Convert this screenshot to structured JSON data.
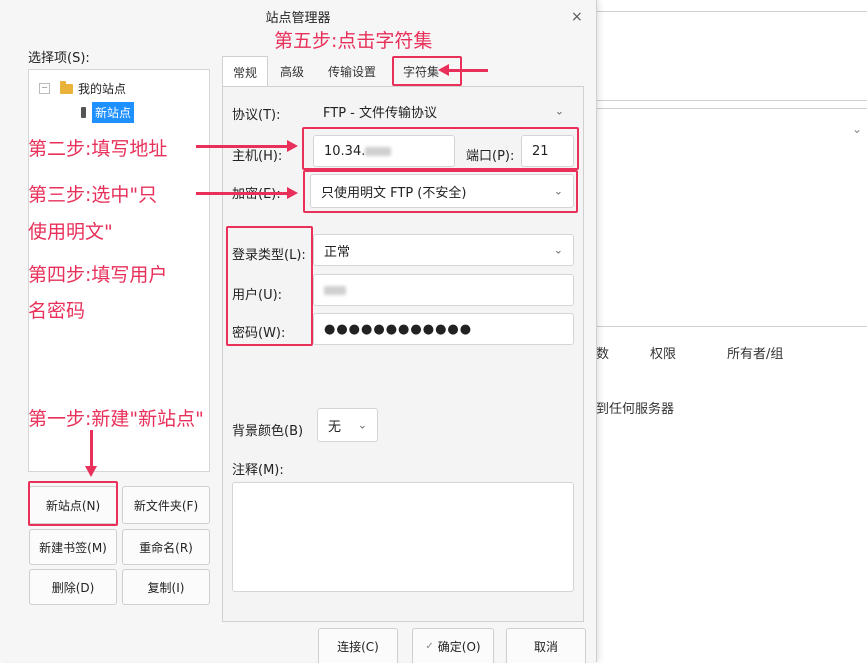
{
  "background_app": {
    "col_permissions": "权限",
    "col_owner": "所有者/组",
    "partial_col": "数",
    "status_text": "到任何服务器"
  },
  "dialog": {
    "title": "站点管理器",
    "close": "×",
    "select_entry_label": "选择项(S):",
    "tree": {
      "collapse": "−",
      "my_sites": "我的站点",
      "new_site": "新站点"
    },
    "buttons": {
      "new_site": "新站点(N)",
      "new_folder": "新文件夹(F)",
      "new_bookmark": "新建书签(M)",
      "rename": "重命名(R)",
      "delete": "删除(D)",
      "copy": "复制(I)"
    },
    "tabs": [
      "常规",
      "高级",
      "传输设置",
      "字符集"
    ],
    "form": {
      "protocol_label": "协议(T):",
      "protocol_value": "FTP - 文件传输协议",
      "host_label": "主机(H):",
      "host_value": "10.34.",
      "port_label": "端口(P):",
      "port_value": "21",
      "encryption_label": "加密(E):",
      "encryption_value": "只使用明文 FTP (不安全)",
      "logon_type_label": "登录类型(L):",
      "logon_type_value": "正常",
      "user_label": "用户(U):",
      "password_label": "密码(W):",
      "password_value": "●●●●●●●●●●●●",
      "bg_color_label": "背景颜色(B)",
      "bg_color_value": "无",
      "comments_label": "注释(M):"
    },
    "footer": {
      "connect": "连接(C)",
      "ok_icon": "✓",
      "ok": "确定(O)",
      "cancel": "取消"
    }
  },
  "annotations": {
    "step1": "第一步:新建\"新站点\"",
    "step2": "第二步:填写地址",
    "step3_line1": "第三步:选中\"只",
    "step3_line2": "使用明文\"",
    "step4_line1": "第四步:填写用户",
    "step4_line2": "名密码",
    "step5": "第五步:点击字符集",
    "color": "#e8305a"
  }
}
